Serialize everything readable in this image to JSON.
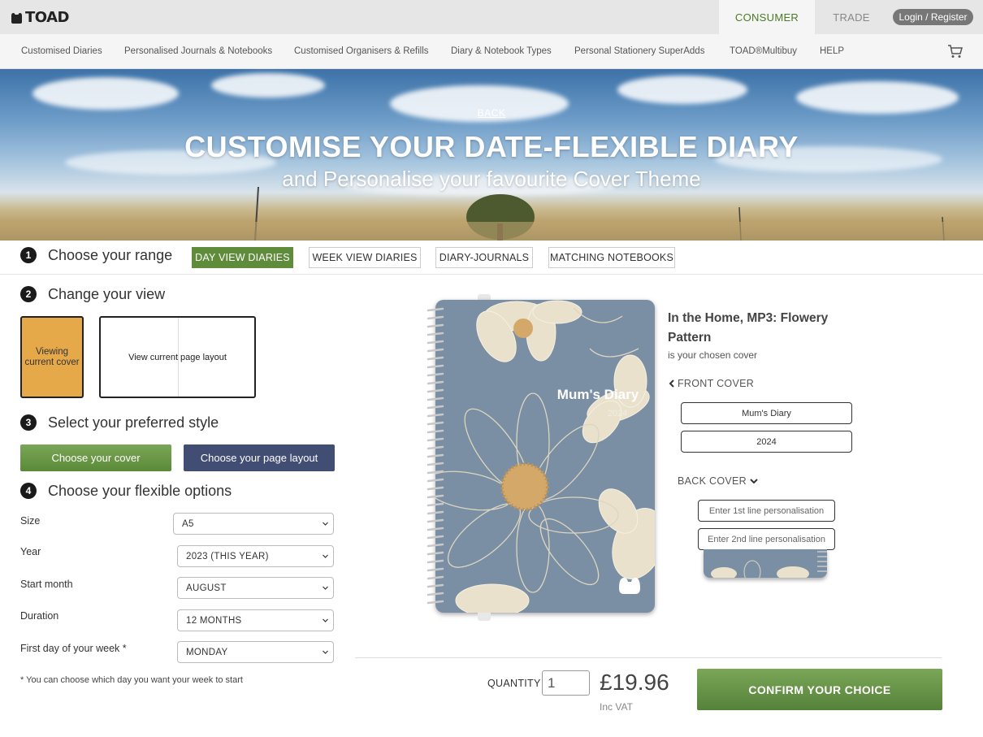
{
  "header": {
    "logo_text": "TOAD",
    "tabs": [
      {
        "label": "CONSUMER",
        "active": true
      },
      {
        "label": "TRADE",
        "active": false
      }
    ],
    "login_label": "Login / Register"
  },
  "nav": {
    "items": [
      "Customised Diaries",
      "Personalised Journals & Notebooks",
      "Customised Organisers & Refills",
      "Diary & Notebook Types",
      "Personal Stationery SuperAdds",
      "TOAD®Multibuy",
      "HELP"
    ],
    "cart_icon": "cart-icon"
  },
  "hero": {
    "back_label": "BACK",
    "title": "CUSTOMISE YOUR DATE-FLEXIBLE DIARY",
    "subtitle": "and Personalise your favourite Cover Theme"
  },
  "steps": [
    {
      "number": "1",
      "title": "Choose your range"
    },
    {
      "number": "2",
      "title": "Change your view"
    },
    {
      "number": "3",
      "title": "Select your preferred style"
    },
    {
      "number": "4",
      "title": "Choose your flexible options"
    }
  ],
  "range": {
    "buttons": [
      {
        "label": "DAY VIEW DIARIES",
        "active": true
      },
      {
        "label": "WEEK VIEW DIARIES",
        "active": false
      },
      {
        "label": "DIARY-JOURNALS",
        "active": false
      },
      {
        "label": "MATCHING NOTEBOOKS",
        "active": false
      }
    ]
  },
  "view": {
    "cover_label": "Viewing current cover",
    "layout_label": "View current page layout"
  },
  "style": {
    "cover_button": "Choose your cover",
    "layout_button": "Choose your page layout"
  },
  "options": {
    "rows": [
      {
        "label": "Size",
        "value": "A5"
      },
      {
        "label": "Year",
        "value": "2023 (THIS YEAR)"
      },
      {
        "label": "Start month",
        "value": "AUGUST"
      },
      {
        "label": "Duration",
        "value": "12 MONTHS"
      },
      {
        "label": "First day of your week *",
        "value": "MONDAY"
      }
    ],
    "footnote": "* You can choose which day you want your week to start"
  },
  "cover": {
    "title": "Mum's Diary",
    "year": "2024",
    "chosen_name": "In the Home, MP3: Flowery Pattern",
    "chosen_sub": "is your chosen cover",
    "front_cover_label": "FRONT COVER",
    "front_line1_value": "Mum's Diary",
    "front_line2_value": "2024",
    "back_cover_label": "BACK COVER",
    "back_line1_placeholder": "Enter 1st line personalisation",
    "back_line2_placeholder": "Enter 2nd line personalisation",
    "colors": {
      "cover": "#7b8fa4",
      "flower": "#e9e1cc",
      "center": "#d4a869"
    }
  },
  "purchase": {
    "quantity_label": "QUANTITY",
    "quantity_value": "1",
    "price": "£19.96",
    "vat_label": "Inc VAT",
    "confirm_label": "CONFIRM YOUR CHOICE"
  },
  "colors": {
    "accent_green": "#5e8c3a",
    "navy": "#414d72",
    "orange": "#e6a94a"
  }
}
